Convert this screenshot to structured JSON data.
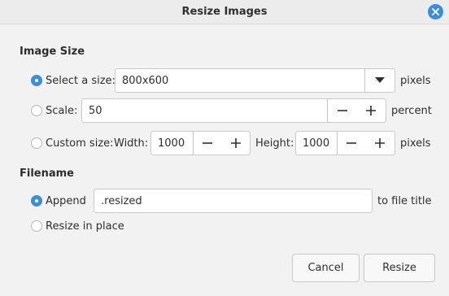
{
  "window": {
    "title": "Resize Images"
  },
  "image_size": {
    "heading": "Image Size",
    "select_size": {
      "label": "Select a size:",
      "selected": true,
      "value": "800x600",
      "unit": "pixels"
    },
    "scale": {
      "label": "Scale:",
      "selected": false,
      "value": "50",
      "unit": "percent"
    },
    "custom": {
      "label": "Custom size:",
      "selected": false,
      "width_label": "Width:",
      "width_value": "1000",
      "height_label": "Height:",
      "height_value": "1000",
      "unit": "pixels"
    }
  },
  "filename": {
    "heading": "Filename",
    "append": {
      "label": "Append",
      "selected": true,
      "value": ".resized",
      "suffix": "to file title"
    },
    "in_place": {
      "label": "Resize in place",
      "selected": false
    }
  },
  "buttons": {
    "cancel": "Cancel",
    "resize": "Resize"
  },
  "colors": {
    "accent": "#3d8ed8"
  }
}
